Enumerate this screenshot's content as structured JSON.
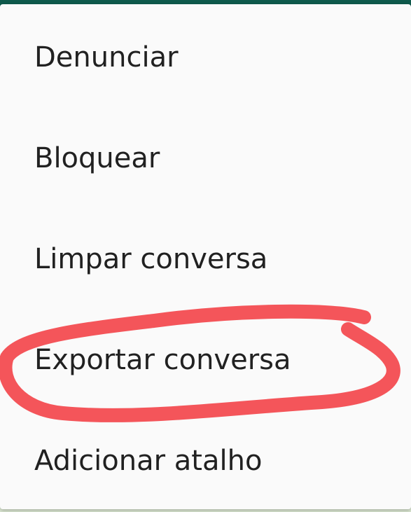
{
  "menu": {
    "items": [
      {
        "label": "Denunciar"
      },
      {
        "label": "Bloquear"
      },
      {
        "label": "Limpar conversa"
      },
      {
        "label": "Exportar conversa"
      },
      {
        "label": "Adicionar atalho"
      }
    ]
  },
  "annotation": {
    "color": "#f4555a",
    "circled_item": "Exportar conversa"
  }
}
